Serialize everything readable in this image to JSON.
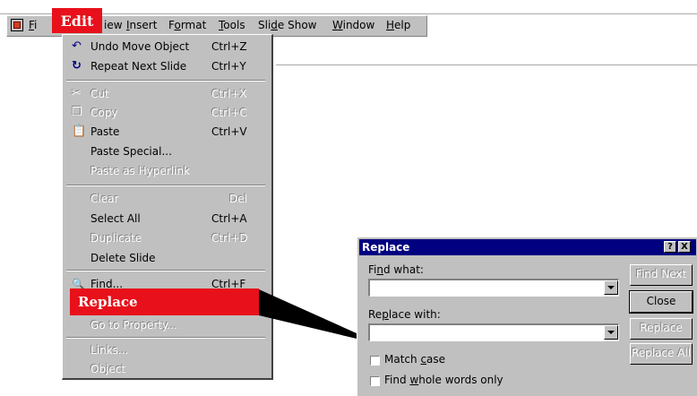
{
  "menubar": {
    "items": [
      {
        "label": "File",
        "shown": "Fi"
      },
      {
        "label": "Edit"
      },
      {
        "label": "View",
        "shown": "iew"
      },
      {
        "label": "Insert"
      },
      {
        "label": "Format"
      },
      {
        "label": "Tools"
      },
      {
        "label": "Slide Show"
      },
      {
        "label": "Window"
      },
      {
        "label": "Help"
      }
    ]
  },
  "callout_edit": "Edit",
  "edit_menu": {
    "items": [
      {
        "label": "Undo Move Object",
        "shortcut": "Ctrl+Z",
        "icon": "undo-icon",
        "enabled": true
      },
      {
        "label": "Repeat Next Slide",
        "shortcut": "Ctrl+Y",
        "icon": "redo-icon",
        "enabled": true
      },
      {
        "label": "Cut",
        "shortcut": "Ctrl+X",
        "icon": "scissors-icon",
        "enabled": false
      },
      {
        "label": "Copy",
        "shortcut": "Ctrl+C",
        "icon": "copy-icon",
        "enabled": false
      },
      {
        "label": "Paste",
        "shortcut": "Ctrl+V",
        "icon": "paste-icon",
        "enabled": true
      },
      {
        "label": "Paste Special...",
        "shortcut": "",
        "enabled": true
      },
      {
        "label": "Paste as Hyperlink",
        "shortcut": "",
        "enabled": false
      },
      {
        "label": "Clear",
        "shortcut": "Del",
        "enabled": false
      },
      {
        "label": "Select All",
        "shortcut": "Ctrl+A",
        "enabled": true
      },
      {
        "label": "Duplicate",
        "shortcut": "Ctrl+D",
        "enabled": false
      },
      {
        "label": "Delete Slide",
        "shortcut": "",
        "enabled": true
      },
      {
        "label": "Find...",
        "shortcut": "Ctrl+F",
        "icon": "binoculars-icon",
        "enabled": true
      },
      {
        "label": "Replace",
        "shortcut": "",
        "enabled": true
      },
      {
        "label": "Go to Property...",
        "shortcut": "",
        "enabled": false
      },
      {
        "label": "Links...",
        "shortcut": "",
        "enabled": false
      },
      {
        "label": "Object",
        "shortcut": "",
        "enabled": false
      }
    ]
  },
  "callout_replace": "Replace",
  "dialog": {
    "title": "Replace",
    "help_button": "?",
    "close_button": "X",
    "find_what_label": "Find what:",
    "find_what_value": "",
    "replace_with_label": "Replace with:",
    "replace_with_value": "",
    "match_case_label": "Match case",
    "match_case_checked": false,
    "whole_words_label": "Find whole words only",
    "whole_words_checked": false,
    "buttons": {
      "find_next": "Find Next",
      "close": "Close",
      "replace": "Replace",
      "replace_all": "Replace All"
    }
  },
  "colors": {
    "callout_red": "#e8101a",
    "title_bar": "#000080",
    "chrome_gray": "#c0c0c0"
  }
}
